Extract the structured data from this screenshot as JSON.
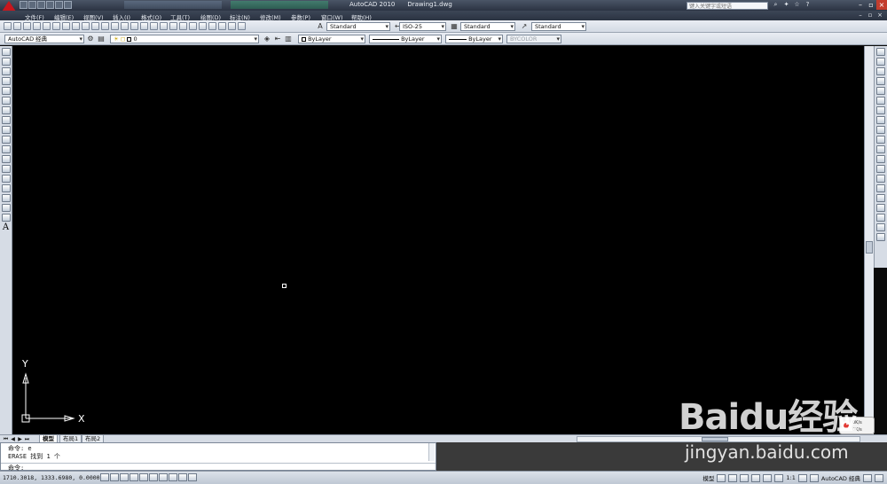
{
  "title_bar": {
    "app_name": "AutoCAD 2010",
    "document": "Drawing1.dwg",
    "search_placeholder": "键入关键字或短语"
  },
  "menu": {
    "items": [
      "文件(F)",
      "编辑(E)",
      "视图(V)",
      "插入(I)",
      "格式(O)",
      "工具(T)",
      "绘图(D)",
      "标注(N)",
      "修改(M)",
      "参数(P)",
      "窗口(W)",
      "帮助(H)"
    ]
  },
  "toolbar": {
    "text_style": "Standard",
    "dim_style": "ISO-25",
    "table_style": "Standard",
    "multileader_style": "Standard",
    "workspace": "AutoCAD 经典",
    "layer": "0",
    "color": "ByLayer",
    "linetype": "ByLayer",
    "lineweight": "ByLayer",
    "plot_style": "BYCOLOR"
  },
  "canvas": {
    "ucs_y": "Y",
    "ucs_x": "X"
  },
  "layout_tabs": [
    "模型",
    "布局1",
    "布局2"
  ],
  "command": {
    "line1": "命令: e",
    "line2": "ERASE 找到 1 个",
    "prompt": "命令:"
  },
  "status": {
    "coordinates": "1710.3018, 1333.6980, 0.0000",
    "model_label": "模型",
    "scale": "1:1",
    "workspace": "AutoCAD 经典"
  },
  "network_widget": {
    "up": "0K/s",
    "down": "0K/s"
  },
  "watermark": {
    "logo": "Baidu经验",
    "url": "jingyan.baidu.com"
  }
}
